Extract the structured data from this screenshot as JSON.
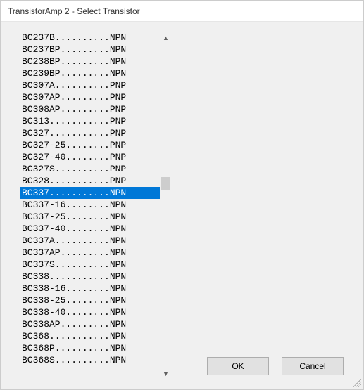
{
  "window": {
    "title": "TransistorAmp 2 - Select Transistor"
  },
  "list": {
    "selected_index": 12,
    "items": [
      {
        "name": "BC237B",
        "type": "NPN"
      },
      {
        "name": "BC237BP",
        "type": "NPN"
      },
      {
        "name": "BC238BP",
        "type": "NPN"
      },
      {
        "name": "BC239BP",
        "type": "NPN"
      },
      {
        "name": "BC307A",
        "type": "PNP"
      },
      {
        "name": "BC307AP",
        "type": "PNP"
      },
      {
        "name": "BC308AP",
        "type": "PNP"
      },
      {
        "name": "BC313",
        "type": "PNP"
      },
      {
        "name": "BC327",
        "type": "PNP"
      },
      {
        "name": "BC327-25",
        "type": "PNP"
      },
      {
        "name": "BC327-40",
        "type": "PNP"
      },
      {
        "name": "BC327S",
        "type": "PNP"
      },
      {
        "name": "BC328",
        "type": "PNP"
      },
      {
        "name": "BC337",
        "type": "NPN"
      },
      {
        "name": "BC337-16",
        "type": "NPN"
      },
      {
        "name": "BC337-25",
        "type": "NPN"
      },
      {
        "name": "BC337-40",
        "type": "NPN"
      },
      {
        "name": "BC337A",
        "type": "NPN"
      },
      {
        "name": "BC337AP",
        "type": "NPN"
      },
      {
        "name": "BC337S",
        "type": "NPN"
      },
      {
        "name": "BC338",
        "type": "NPN"
      },
      {
        "name": "BC338-16",
        "type": "NPN"
      },
      {
        "name": "BC338-25",
        "type": "NPN"
      },
      {
        "name": "BC338-40",
        "type": "NPN"
      },
      {
        "name": "BC338AP",
        "type": "NPN"
      },
      {
        "name": "BC368",
        "type": "NPN"
      },
      {
        "name": "BC368P",
        "type": "NPN"
      },
      {
        "name": "BC368S",
        "type": "NPN"
      }
    ]
  },
  "buttons": {
    "ok": "OK",
    "cancel": "Cancel"
  },
  "format": {
    "total_width": 19
  }
}
